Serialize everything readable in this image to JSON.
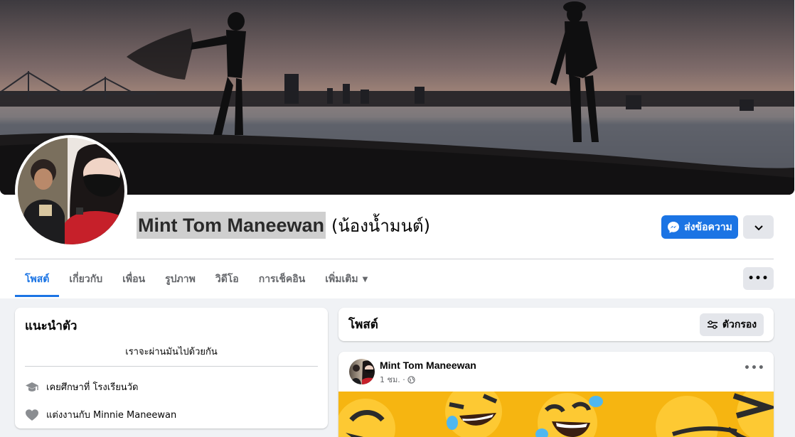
{
  "profile": {
    "name": "Mint Tom Maneewan",
    "nickname": "(น้องน้ำมนต์)"
  },
  "actions": {
    "message_label": "ส่งข้อความ",
    "message_icon": "messenger-icon",
    "dropdown_icon": "chevron-down-icon",
    "more_icon": "more-horizontal-icon",
    "more_glyph": "•••"
  },
  "tabs": [
    {
      "label": "โพสต์",
      "active": true
    },
    {
      "label": "เกี่ยวกับ"
    },
    {
      "label": "เพื่อน"
    },
    {
      "label": "รูปภาพ"
    },
    {
      "label": "วิดีโอ"
    },
    {
      "label": "การเช็คอิน"
    },
    {
      "label": "เพิ่มเติม",
      "caret": "▼"
    }
  ],
  "intro": {
    "title": "แนะนำตัว",
    "bio": "เราจะผ่านมันไปด้วยกัน",
    "education": "เคยศึกษาที่ โรงเรียนวัด",
    "education_icon": "graduation-cap-icon",
    "relationship": "แต่งงานกับ Minnie Maneewan",
    "relationship_icon": "heart-icon"
  },
  "posts": {
    "title": "โพสต์",
    "filter_label": "ตัวกรอง",
    "filter_icon": "filter-sliders-icon"
  },
  "post": {
    "author": "Mint Tom Maneewan",
    "time": "1 ชม. ·",
    "privacy_icon": "globe-icon",
    "more_glyph": "•••"
  },
  "colors": {
    "accent": "#1b74e4",
    "button_gray": "#e4e6eb",
    "page_bg": "#f0f2f5",
    "emoji_yellow": "#f6b511"
  }
}
